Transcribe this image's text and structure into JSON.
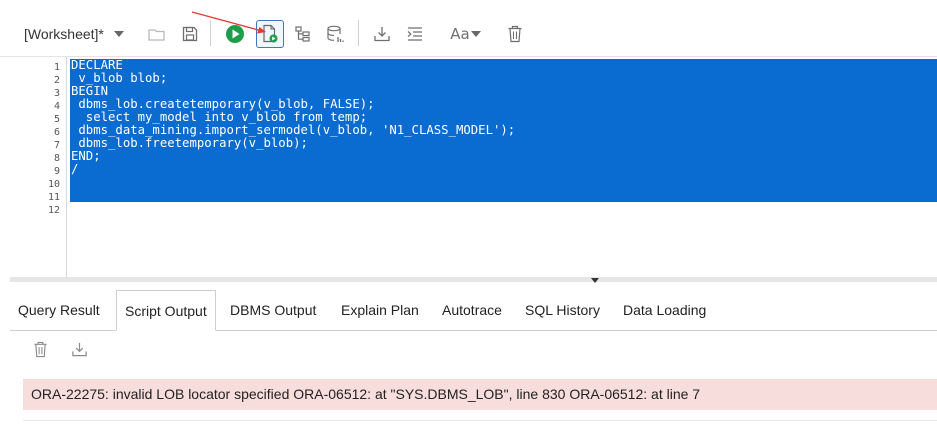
{
  "toolbar": {
    "title": "[Worksheet]*",
    "buttons": [
      {
        "name": "open-file",
        "icon": "folder-icon"
      },
      {
        "name": "save",
        "icon": "save-icon"
      },
      {
        "name": "run-statement",
        "icon": "run-icon",
        "color": "#1e9e4a"
      },
      {
        "name": "run-script",
        "icon": "run-script-icon",
        "active": true
      },
      {
        "name": "explain-plan",
        "icon": "explain-plan-icon"
      },
      {
        "name": "autotrace",
        "icon": "autotrace-icon"
      },
      {
        "name": "download",
        "icon": "download-icon"
      },
      {
        "name": "format",
        "icon": "format-icon"
      },
      {
        "name": "case-toggle",
        "icon": "case-icon",
        "label": "Aa"
      },
      {
        "name": "clear",
        "icon": "trash-icon"
      }
    ]
  },
  "editor": {
    "line_numbers": [
      "1",
      "2",
      "3",
      "4",
      "5",
      "6",
      "7",
      "8",
      "9",
      "10",
      "11",
      "12"
    ],
    "lines": [
      "DECLARE",
      " v_blob blob;",
      "BEGIN",
      " dbms_lob.createtemporary(v_blob, FALSE);",
      "  select my_model into v_blob from temp;",
      " dbms_data_mining.import_sermodel(v_blob, 'N1_CLASS_MODEL');",
      " dbms_lob.freetemporary(v_blob);",
      "END;",
      "/",
      "",
      "",
      ""
    ],
    "selection_color": "#0a6bd1"
  },
  "tabs": [
    {
      "label": "Query Result",
      "active": false
    },
    {
      "label": "Script Output",
      "active": true
    },
    {
      "label": "DBMS Output",
      "active": false
    },
    {
      "label": "Explain Plan",
      "active": false
    },
    {
      "label": "Autotrace",
      "active": false
    },
    {
      "label": "SQL History",
      "active": false
    },
    {
      "label": "Data Loading",
      "active": false
    }
  ],
  "output": {
    "error_text": "ORA-22275: invalid LOB locator specified ORA-06512: at \"SYS.DBMS_LOB\", line 830 ORA-06512: at line 7",
    "error_background": "#f7dedd"
  },
  "annotation_color": "#e53935"
}
